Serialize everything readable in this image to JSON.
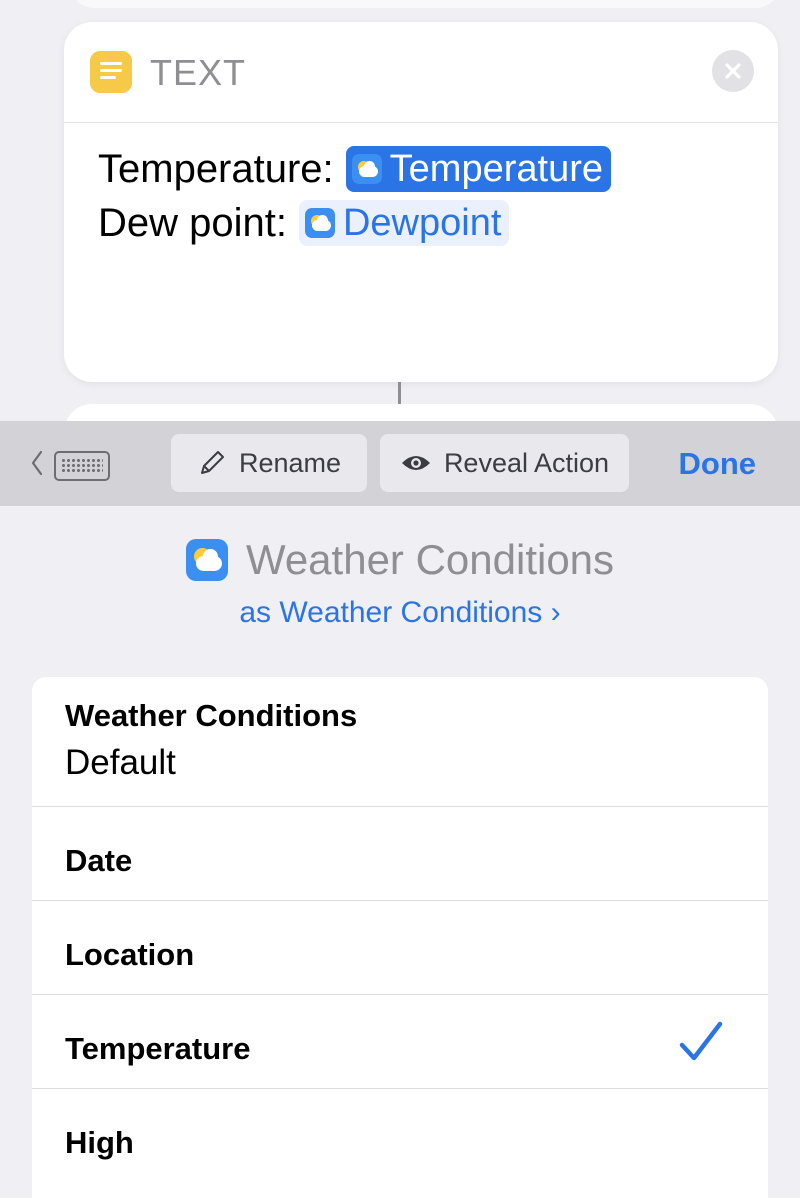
{
  "text_action": {
    "header_label": "TEXT",
    "line1_label": "Temperature:",
    "line1_token": "Temperature",
    "line2_label": "Dew point:",
    "line2_token": "Dewpoint"
  },
  "toolbar": {
    "rename_label": "Rename",
    "reveal_label": "Reveal Action",
    "done_label": "Done"
  },
  "variable": {
    "title": "Weather Conditions",
    "type_link": "as Weather Conditions ›"
  },
  "list": {
    "items": [
      {
        "label": "Weather Conditions",
        "value": "Default"
      },
      {
        "label": "Date"
      },
      {
        "label": "Location"
      },
      {
        "label": "Temperature",
        "selected": true
      },
      {
        "label": "High"
      }
    ]
  },
  "colors": {
    "accent": "#2b74e6",
    "text_icon": "#f7c948",
    "weather_icon": "#3b8ff0"
  },
  "icons": [
    "text-action-icon",
    "close-icon",
    "weather-icon",
    "keyboard-icon",
    "pencil-icon",
    "eye-icon",
    "checkmark-icon"
  ]
}
